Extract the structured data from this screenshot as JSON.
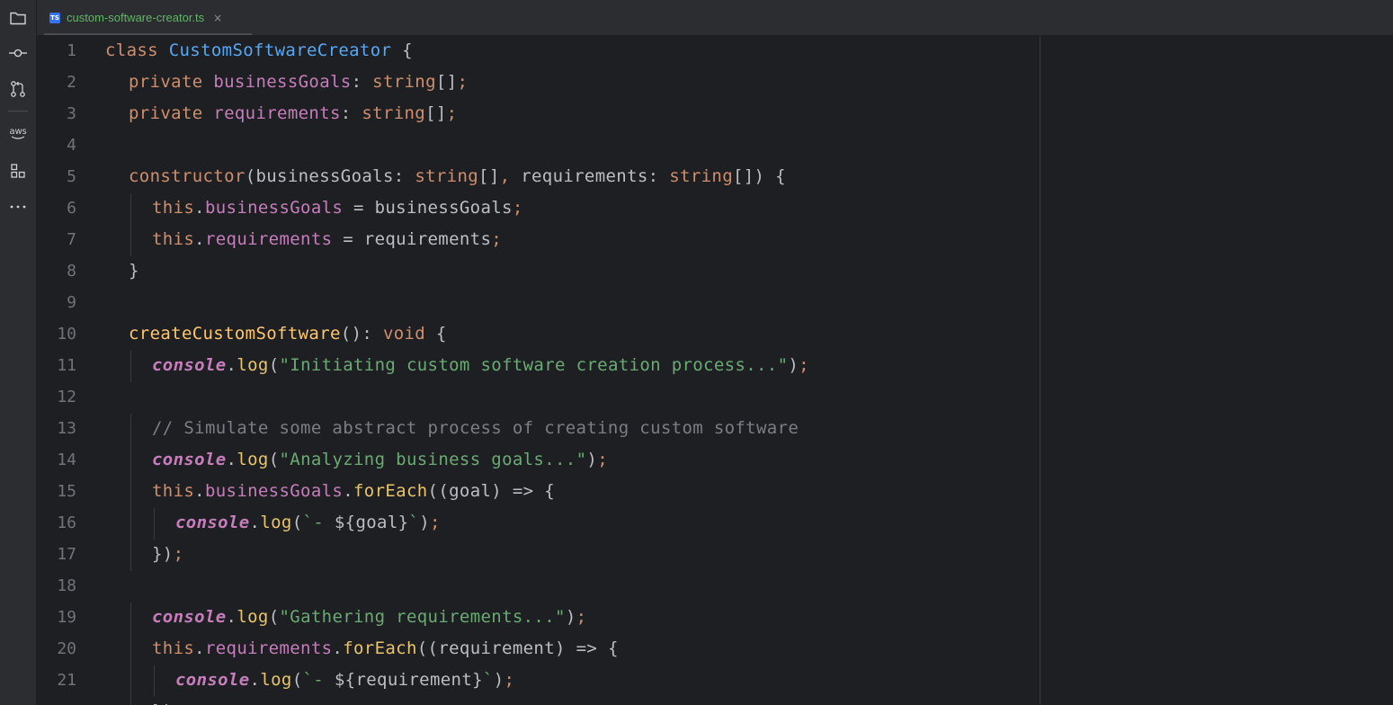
{
  "toolstrip": {
    "items": [
      {
        "name": "project-folder-icon"
      },
      {
        "name": "commit-icon"
      },
      {
        "name": "pull-requests-icon"
      },
      {
        "name": "aws-icon",
        "label": "aws"
      },
      {
        "name": "structure-icon"
      },
      {
        "name": "more-icon"
      }
    ]
  },
  "tabbar": {
    "active_tab": {
      "icon_label": "TS",
      "filename": "custom-software-creator.ts",
      "close_glyph": "×"
    }
  },
  "colors": {
    "keyword": "#cf8e6d",
    "class_name": "#56a8f5",
    "field": "#c77dbb",
    "function": "#ffc66d",
    "string": "#6aab73",
    "comment": "#7a7e85",
    "plain": "#bcbec4",
    "line_number": "#6f737a",
    "tab_filename": "#5fb865"
  },
  "editor": {
    "lines": [
      {
        "n": "1",
        "indent": 0,
        "tokens": [
          [
            "kw",
            "class "
          ],
          [
            "cls",
            "CustomSoftwareCreator"
          ],
          [
            "plain",
            " {"
          ]
        ]
      },
      {
        "n": "2",
        "indent": 1,
        "tokens": [
          [
            "kw",
            "private "
          ],
          [
            "fld",
            "businessGoals"
          ],
          [
            "plain",
            ": "
          ],
          [
            "type",
            "string"
          ],
          [
            "plain",
            "[]"
          ],
          [
            "semi",
            ";"
          ]
        ]
      },
      {
        "n": "3",
        "indent": 1,
        "tokens": [
          [
            "kw",
            "private "
          ],
          [
            "fld",
            "requirements"
          ],
          [
            "plain",
            ": "
          ],
          [
            "type",
            "string"
          ],
          [
            "plain",
            "[]"
          ],
          [
            "semi",
            ";"
          ]
        ]
      },
      {
        "n": "4",
        "indent": 0,
        "tokens": []
      },
      {
        "n": "5",
        "indent": 1,
        "tokens": [
          [
            "kw",
            "constructor"
          ],
          [
            "plain",
            "(businessGoals: "
          ],
          [
            "type",
            "string"
          ],
          [
            "plain",
            "[]"
          ],
          [
            "semi",
            ", "
          ],
          [
            "plain",
            "requirements: "
          ],
          [
            "type",
            "string"
          ],
          [
            "plain",
            "[]) {"
          ]
        ]
      },
      {
        "n": "6",
        "indent": 2,
        "tokens": [
          [
            "this",
            "this"
          ],
          [
            "plain",
            "."
          ],
          [
            "fld",
            "businessGoals"
          ],
          [
            "plain",
            " = businessGoals"
          ],
          [
            "semi",
            ";"
          ]
        ]
      },
      {
        "n": "7",
        "indent": 2,
        "tokens": [
          [
            "this",
            "this"
          ],
          [
            "plain",
            "."
          ],
          [
            "fld",
            "requirements"
          ],
          [
            "plain",
            " = requirements"
          ],
          [
            "semi",
            ";"
          ]
        ]
      },
      {
        "n": "8",
        "indent": 1,
        "tokens": [
          [
            "plain",
            "}"
          ]
        ]
      },
      {
        "n": "9",
        "indent": 0,
        "tokens": []
      },
      {
        "n": "10",
        "indent": 1,
        "tokens": [
          [
            "fn",
            "createCustomSoftware"
          ],
          [
            "plain",
            "(): "
          ],
          [
            "type",
            "void"
          ],
          [
            "plain",
            " {"
          ]
        ]
      },
      {
        "n": "11",
        "indent": 2,
        "tokens": [
          [
            "con",
            "console"
          ],
          [
            "plain",
            "."
          ],
          [
            "meth",
            "log"
          ],
          [
            "plain",
            "("
          ],
          [
            "str",
            "\"Initiating custom software creation process...\""
          ],
          [
            "plain",
            ")"
          ],
          [
            "semi",
            ";"
          ]
        ]
      },
      {
        "n": "12",
        "indent": 0,
        "tokens": []
      },
      {
        "n": "13",
        "indent": 2,
        "tokens": [
          [
            "cmt",
            "// Simulate some abstract process of creating custom software"
          ]
        ]
      },
      {
        "n": "14",
        "indent": 2,
        "tokens": [
          [
            "con",
            "console"
          ],
          [
            "plain",
            "."
          ],
          [
            "meth",
            "log"
          ],
          [
            "plain",
            "("
          ],
          [
            "str",
            "\"Analyzing business goals...\""
          ],
          [
            "plain",
            ")"
          ],
          [
            "semi",
            ";"
          ]
        ]
      },
      {
        "n": "15",
        "indent": 2,
        "tokens": [
          [
            "this",
            "this"
          ],
          [
            "plain",
            "."
          ],
          [
            "fld",
            "businessGoals"
          ],
          [
            "plain",
            "."
          ],
          [
            "meth",
            "forEach"
          ],
          [
            "plain",
            "((goal) => {"
          ]
        ]
      },
      {
        "n": "16",
        "indent": 3,
        "tokens": [
          [
            "con",
            "console"
          ],
          [
            "plain",
            "."
          ],
          [
            "meth",
            "log"
          ],
          [
            "plain",
            "("
          ],
          [
            "str",
            "`- "
          ],
          [
            "plain",
            "${goal}"
          ],
          [
            "str",
            "`"
          ],
          [
            "plain",
            ")"
          ],
          [
            "semi",
            ";"
          ]
        ]
      },
      {
        "n": "17",
        "indent": 2,
        "tokens": [
          [
            "plain",
            "})"
          ],
          [
            "semi",
            ";"
          ]
        ]
      },
      {
        "n": "18",
        "indent": 0,
        "tokens": []
      },
      {
        "n": "19",
        "indent": 2,
        "tokens": [
          [
            "con",
            "console"
          ],
          [
            "plain",
            "."
          ],
          [
            "meth",
            "log"
          ],
          [
            "plain",
            "("
          ],
          [
            "str",
            "\"Gathering requirements...\""
          ],
          [
            "plain",
            ")"
          ],
          [
            "semi",
            ";"
          ]
        ]
      },
      {
        "n": "20",
        "indent": 2,
        "tokens": [
          [
            "this",
            "this"
          ],
          [
            "plain",
            "."
          ],
          [
            "fld",
            "requirements"
          ],
          [
            "plain",
            "."
          ],
          [
            "meth",
            "forEach"
          ],
          [
            "plain",
            "((requirement) => {"
          ]
        ]
      },
      {
        "n": "21",
        "indent": 3,
        "tokens": [
          [
            "con",
            "console"
          ],
          [
            "plain",
            "."
          ],
          [
            "meth",
            "log"
          ],
          [
            "plain",
            "("
          ],
          [
            "str",
            "`- "
          ],
          [
            "plain",
            "${requirement}"
          ],
          [
            "str",
            "`"
          ],
          [
            "plain",
            ")"
          ],
          [
            "semi",
            ";"
          ]
        ]
      },
      {
        "n": "",
        "indent": 2,
        "tokens": [
          [
            "plain",
            "})"
          ],
          [
            "semi",
            ";"
          ]
        ]
      }
    ]
  }
}
